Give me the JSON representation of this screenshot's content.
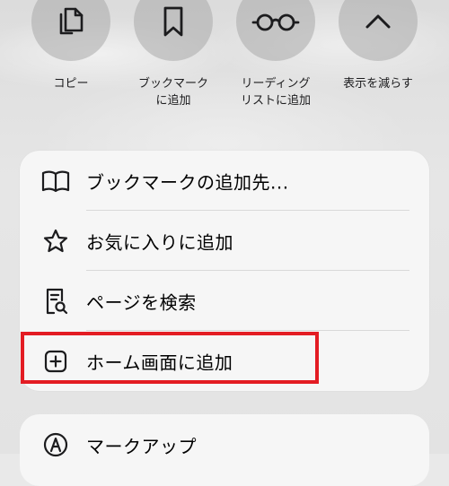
{
  "quick_actions": [
    {
      "label": "コピー",
      "icon": "copy-icon"
    },
    {
      "label": "ブックマーク\nに追加",
      "icon": "bookmark-icon"
    },
    {
      "label": "リーディング\nリストに追加",
      "icon": "reading-glasses-icon"
    },
    {
      "label": "表示を減らす",
      "icon": "chevron-up-icon"
    }
  ],
  "menu": {
    "items": [
      {
        "label": "ブックマークの追加先...",
        "icon": "book-icon"
      },
      {
        "label": "お気に入りに追加",
        "icon": "star-icon"
      },
      {
        "label": "ページを検索",
        "icon": "find-in-page-icon"
      },
      {
        "label": "ホーム画面に追加",
        "icon": "add-square-icon",
        "highlighted": true
      }
    ]
  },
  "menu2": {
    "items": [
      {
        "label": "マークアップ",
        "icon": "markup-pen-icon"
      }
    ]
  },
  "colors": {
    "highlight": "#e31c23"
  }
}
